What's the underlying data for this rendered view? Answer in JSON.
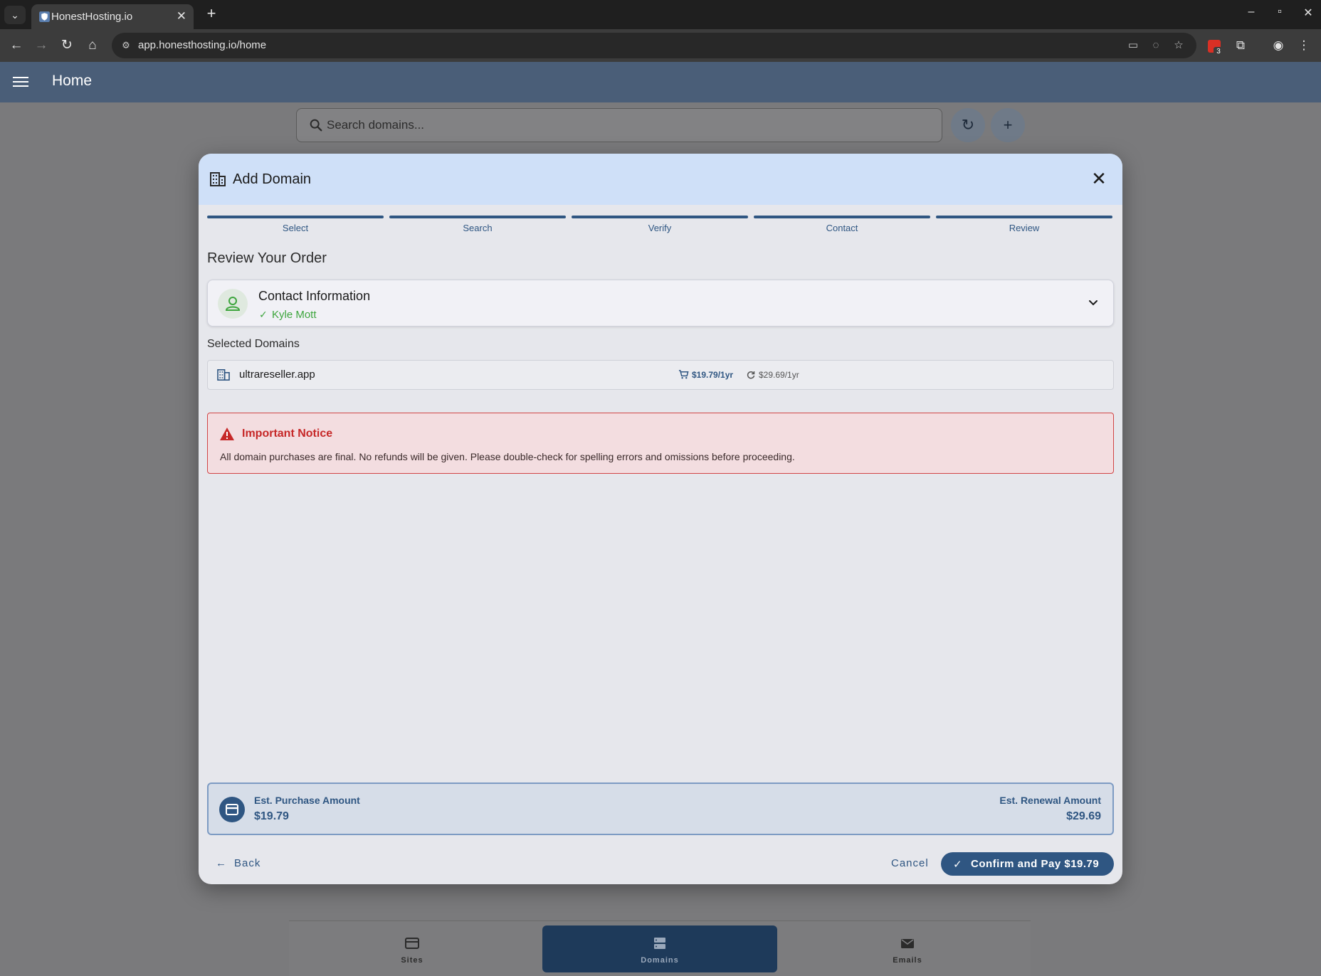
{
  "browser": {
    "tab_title": "HonestHosting.io",
    "url": "app.honesthosting.io/home",
    "extension_badge": "3"
  },
  "app": {
    "title": "Home",
    "search": {
      "placeholder": "Search domains..."
    }
  },
  "dialog": {
    "title": "Add Domain",
    "steps": [
      "Select",
      "Search",
      "Verify",
      "Contact",
      "Review"
    ],
    "review_title": "Review Your Order",
    "contact": {
      "title": "Contact Information",
      "name": "Kyle Mott"
    },
    "selected_label": "Selected Domains",
    "domains": [
      {
        "name": "ultrareseller.app",
        "price": "$19.79/1yr",
        "renewal": "$29.69/1yr"
      }
    ],
    "notice": {
      "title": "Important Notice",
      "text": "All domain purchases are final. No refunds will be given. Please double-check for spelling errors and omissions before proceeding."
    },
    "summary": {
      "purchase_label": "Est. Purchase Amount",
      "purchase_value": "$19.79",
      "renewal_label": "Est. Renewal Amount",
      "renewal_value": "$29.69"
    },
    "buttons": {
      "back": "Back",
      "cancel": "Cancel",
      "confirm": "Confirm and Pay $19.79"
    }
  },
  "bottom_nav": [
    {
      "label": "Sites",
      "icon": "sites-icon"
    },
    {
      "label": "Domains",
      "icon": "domains-icon",
      "active": true
    },
    {
      "label": "Emails",
      "icon": "email-icon"
    }
  ],
  "colors": {
    "primary": "#2f5682",
    "success": "#3da53d",
    "danger": "#c62828",
    "dialog_header": "#cfe0f8"
  }
}
